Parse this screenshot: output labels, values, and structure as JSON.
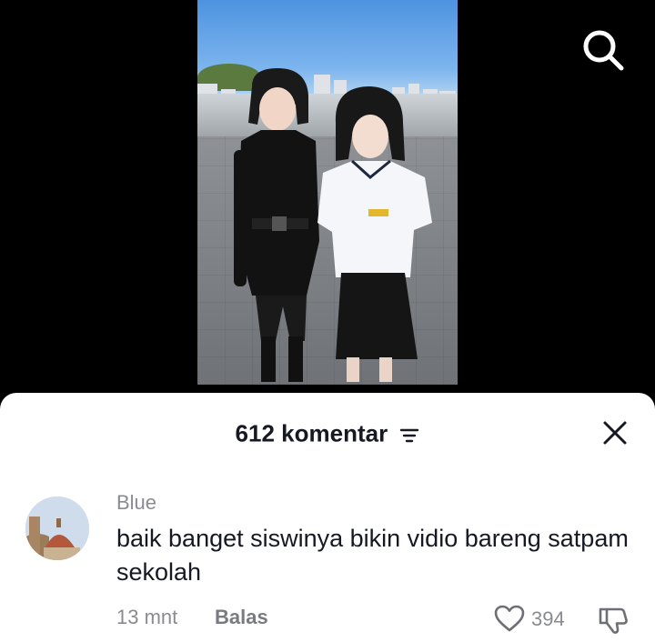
{
  "video": {
    "search_icon": "search-icon"
  },
  "comments_sheet": {
    "count_label": "612 komentar",
    "sort_icon": "sort-lines-icon",
    "close_icon": "close-x-icon"
  },
  "comment": {
    "username": "Blue",
    "text": "baik banget siswinya bikin vidio bareng satpam sekolah",
    "time_label": "13 mnt",
    "reply_label": "Balas",
    "like_icon": "heart-outline-icon",
    "like_count": "394",
    "dislike_icon": "thumbs-down-icon"
  },
  "colors": {
    "sheet_background": "#ffffff",
    "primary_text": "#161823",
    "secondary_text": "#8a8b91",
    "video_letterbox": "#000000"
  }
}
